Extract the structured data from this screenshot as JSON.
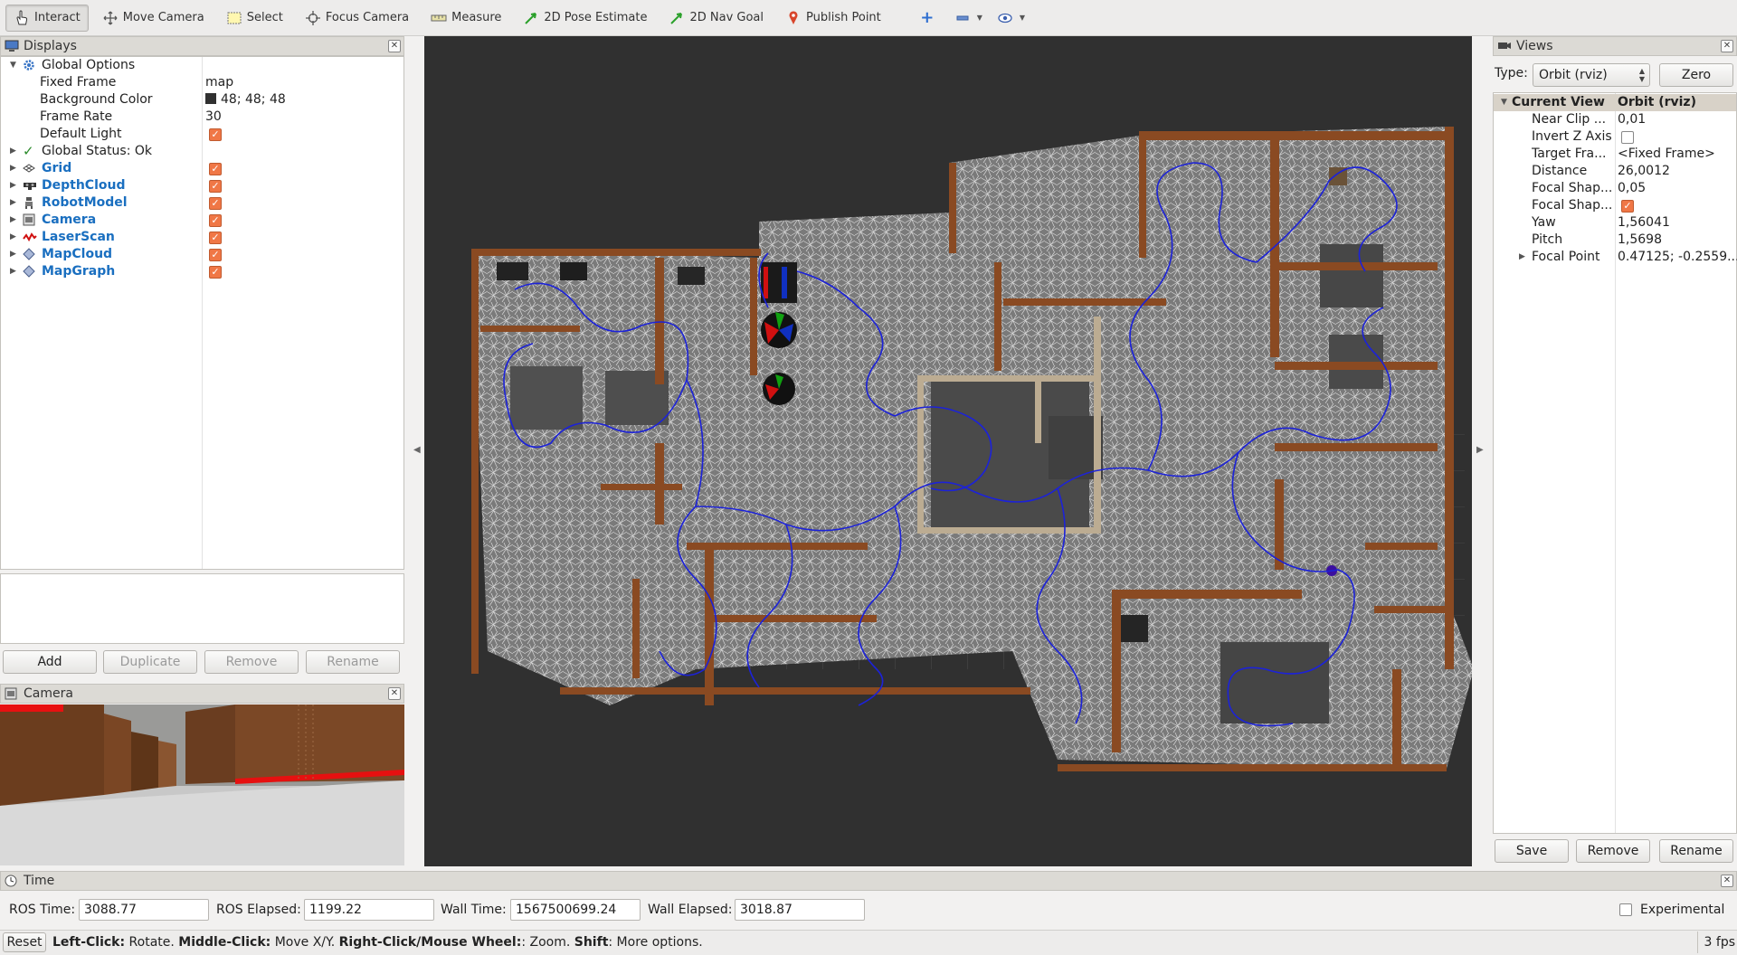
{
  "toolbar": {
    "tools": [
      {
        "label": "Interact",
        "icon": "hand-pointer-icon"
      },
      {
        "label": "Move Camera",
        "icon": "move-camera-icon"
      },
      {
        "label": "Select",
        "icon": "select-box-icon"
      },
      {
        "label": "Focus Camera",
        "icon": "focus-camera-icon"
      },
      {
        "label": "Measure",
        "icon": "ruler-icon"
      },
      {
        "label": "2D Pose Estimate",
        "icon": "green-arrow-icon"
      },
      {
        "label": "2D Nav Goal",
        "icon": "green-arrow-icon"
      },
      {
        "label": "Publish Point",
        "icon": "map-pin-icon"
      }
    ]
  },
  "displays": {
    "title": "Displays",
    "global_options": {
      "label": "Global Options",
      "fixed_frame": {
        "name": "Fixed Frame",
        "value": "map"
      },
      "background_color": {
        "name": "Background Color",
        "value": "48; 48; 48",
        "color": "#303030"
      },
      "frame_rate": {
        "name": "Frame Rate",
        "value": "30"
      },
      "default_light": {
        "name": "Default Light",
        "checked": true
      }
    },
    "global_status": "Global Status: Ok",
    "items": [
      {
        "label": "Grid",
        "icon": "grid-icon",
        "checked": true
      },
      {
        "label": "DepthCloud",
        "icon": "depth-camera-icon",
        "checked": true
      },
      {
        "label": "RobotModel",
        "icon": "robot-icon",
        "checked": true
      },
      {
        "label": "Camera",
        "icon": "camera-icon",
        "checked": true
      },
      {
        "label": "LaserScan",
        "icon": "laser-scan-icon",
        "checked": true
      },
      {
        "label": "MapCloud",
        "icon": "diamond-icon",
        "checked": true
      },
      {
        "label": "MapGraph",
        "icon": "diamond-icon",
        "checked": true
      }
    ],
    "buttons": {
      "add": "Add",
      "duplicate": "Duplicate",
      "remove": "Remove",
      "rename": "Rename"
    }
  },
  "camera": {
    "title": "Camera"
  },
  "views": {
    "title": "Views",
    "type_label": "Type:",
    "type_value": "Orbit (rviz)",
    "zero": "Zero",
    "current_view": {
      "name": "Current View",
      "value": "Orbit (rviz)"
    },
    "props": [
      {
        "name": "Near Clip ...",
        "value": "0,01"
      },
      {
        "name": "Invert Z Axis",
        "value": ""
      },
      {
        "name": "Target Fra...",
        "value": "<Fixed Frame>"
      },
      {
        "name": "Distance",
        "value": "26,0012"
      },
      {
        "name": "Focal Shap...",
        "value": "0,05"
      },
      {
        "name": "Focal Shap...",
        "value": ""
      },
      {
        "name": "Yaw",
        "value": "1,56041"
      },
      {
        "name": "Pitch",
        "value": "1,5698"
      },
      {
        "name": "Focal Point",
        "value": "0.47125; -0.2559..."
      }
    ],
    "buttons": {
      "save": "Save",
      "remove": "Remove",
      "rename": "Rename"
    }
  },
  "time": {
    "title": "Time",
    "ros_time_label": "ROS Time:",
    "ros_time": "3088.77",
    "ros_elapsed_label": "ROS Elapsed:",
    "ros_elapsed": "1199.22",
    "wall_time_label": "Wall Time:",
    "wall_time": "1567500699.24",
    "wall_elapsed_label": "Wall Elapsed:",
    "wall_elapsed": "3018.87",
    "experimental": "Experimental"
  },
  "status": {
    "reset": "Reset",
    "left_click": "Left-Click:",
    "left_click_desc": " Rotate. ",
    "middle_click": "Middle-Click:",
    "middle_click_desc": " Move X/Y. ",
    "right_click": "Right-Click/Mouse Wheel:",
    "right_click_desc": ": Zoom. ",
    "shift": "Shift",
    "shift_desc": ": More options.",
    "fps": "3 fps"
  },
  "colors": {
    "accent_check": "#f07746",
    "link_blue": "#1a6fc0",
    "path_blue": "#1c22d8",
    "viewport_bg": "#303030",
    "wall_brown": "#8a4a22"
  }
}
